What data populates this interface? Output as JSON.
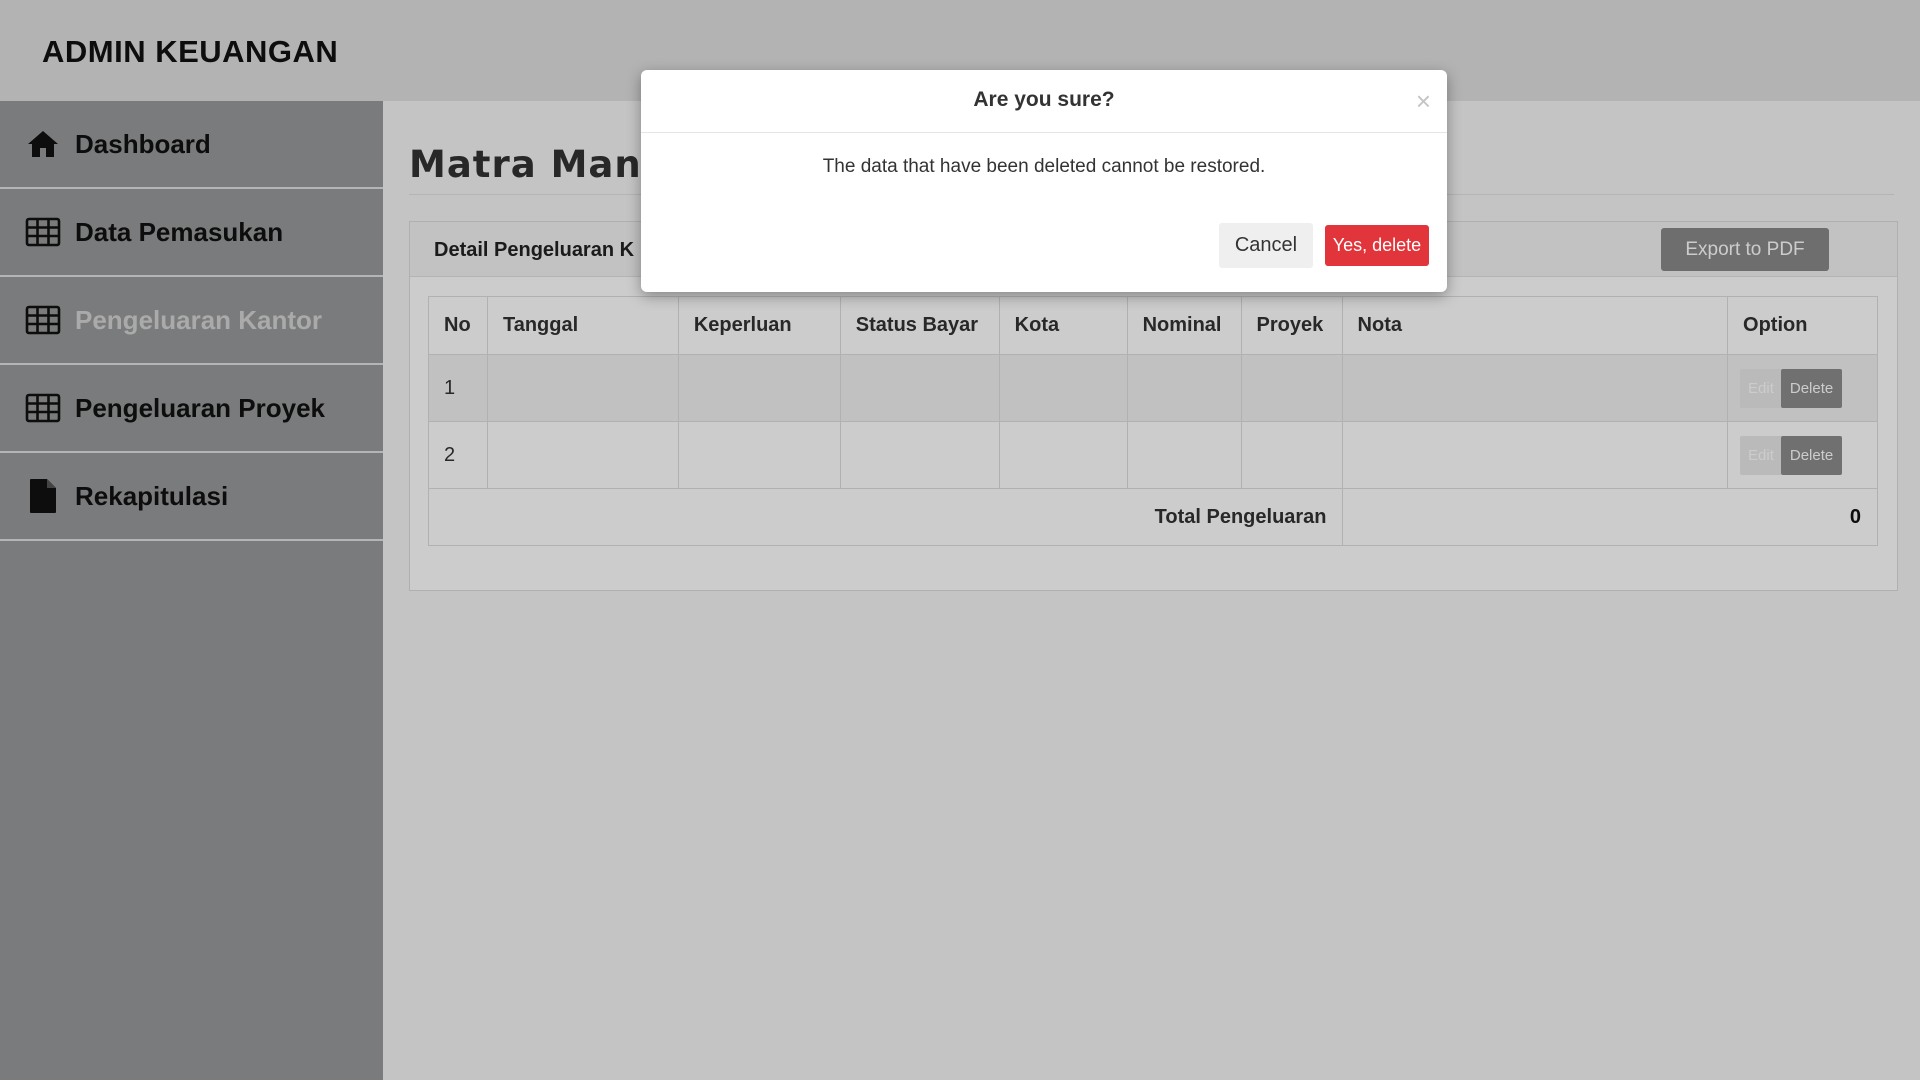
{
  "app": {
    "title": "ADMIN KEUANGAN"
  },
  "sidebar": {
    "items": [
      {
        "label": "Dashboard",
        "icon": "home-icon",
        "active": false
      },
      {
        "label": "Data Pemasukan",
        "icon": "table-icon",
        "active": false
      },
      {
        "label": "Pengeluaran Kantor",
        "icon": "table-icon",
        "active": true
      },
      {
        "label": "Pengeluaran Proyek",
        "icon": "table-icon",
        "active": false
      },
      {
        "label": "Rekapitulasi",
        "icon": "file-icon",
        "active": false
      }
    ]
  },
  "main": {
    "page_title": "Matra Mandiri",
    "panel": {
      "title": "Detail Pengeluaran K",
      "export_label": "Export to PDF"
    },
    "table": {
      "headers": [
        "No",
        "Tanggal",
        "Keperluan",
        "Status Bayar",
        "Kota",
        "Nominal",
        "Proyek",
        "Nota",
        "Option"
      ],
      "rows": [
        {
          "no": "1",
          "edit_label": "Edit",
          "delete_label": "Delete"
        },
        {
          "no": "2",
          "edit_label": "Edit",
          "delete_label": "Delete"
        }
      ],
      "total_label": "Total Pengeluaran",
      "total_value": "0"
    }
  },
  "modal": {
    "title": "Are you sure?",
    "close_symbol": "×",
    "message": "The data that have been deleted cannot be restored.",
    "cancel_label": "Cancel",
    "confirm_label": "Yes, delete"
  },
  "colors": {
    "confirm": "#e2343b",
    "sidebar": "#999a9b",
    "header": "#e0e0e0"
  }
}
